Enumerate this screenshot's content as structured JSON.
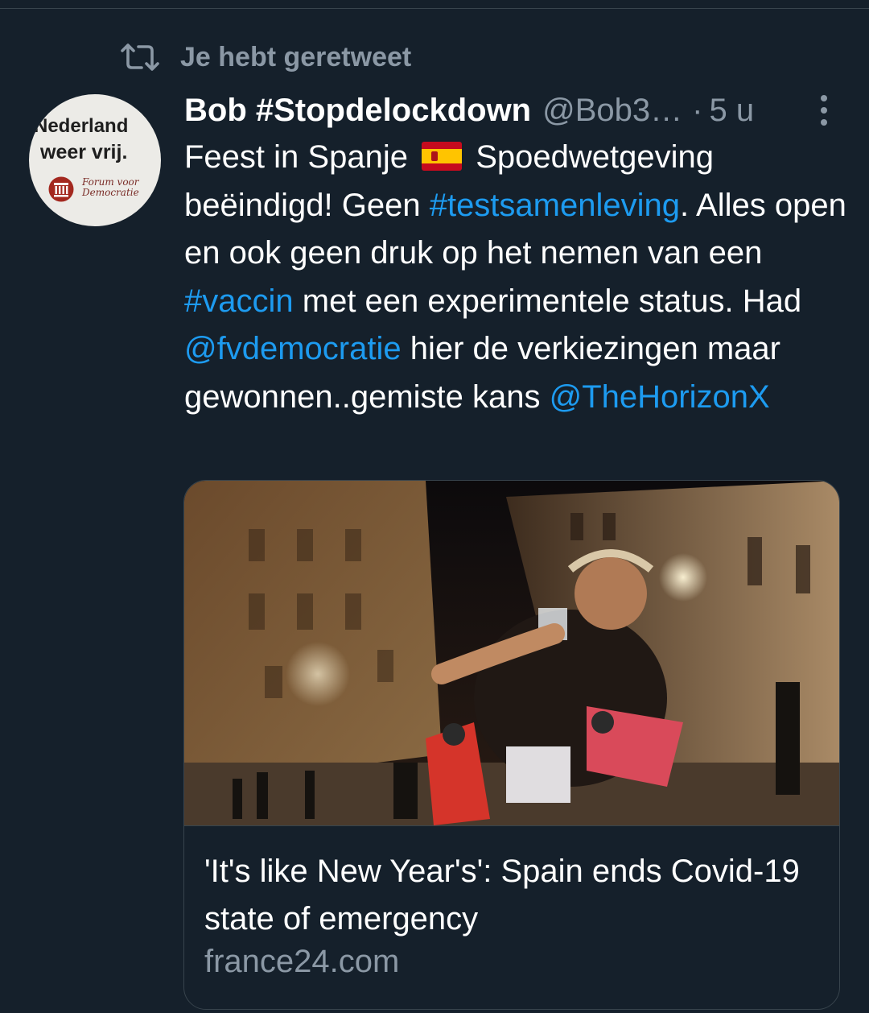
{
  "retweet": {
    "icon": "retweet-icon",
    "label": "Je hebt geretweet"
  },
  "tweet": {
    "avatar": {
      "line1": "Nederland",
      "line2": "weer vrij.",
      "logo_text_1": "Forum voor",
      "logo_text_2": "Democratie",
      "logo_color": "#7a2c27"
    },
    "display_name": "Bob #Stopdelockdown",
    "handle": "@Bob3…",
    "separator": "·",
    "time": "5 u",
    "more_icon": "more-vertical-icon",
    "text": {
      "part1": "Feest in Spanje",
      "flag_icon": "spain-flag-icon",
      "part2": "Spoedwetgeving beëindigd! Geen",
      "hashtag1": "#testsamenleving",
      "part3": ". Alles open en ook geen druk op het nemen van een",
      "hashtag2": "#vaccin",
      "part4": "met een experimentele status. Had",
      "mention1": "@fvdemocratie",
      "part5": "hier de verkiezingen maar gewonnen..gemiste kans",
      "mention2": "@TheHorizonX"
    },
    "card": {
      "title": "'It's like New Year's': Spain ends Covid-19 state of emergency",
      "domain": "france24.com"
    }
  },
  "colors": {
    "background": "#15202b",
    "link": "#1d9bf0",
    "secondary_text": "#8b98a5",
    "border": "#38444d"
  }
}
